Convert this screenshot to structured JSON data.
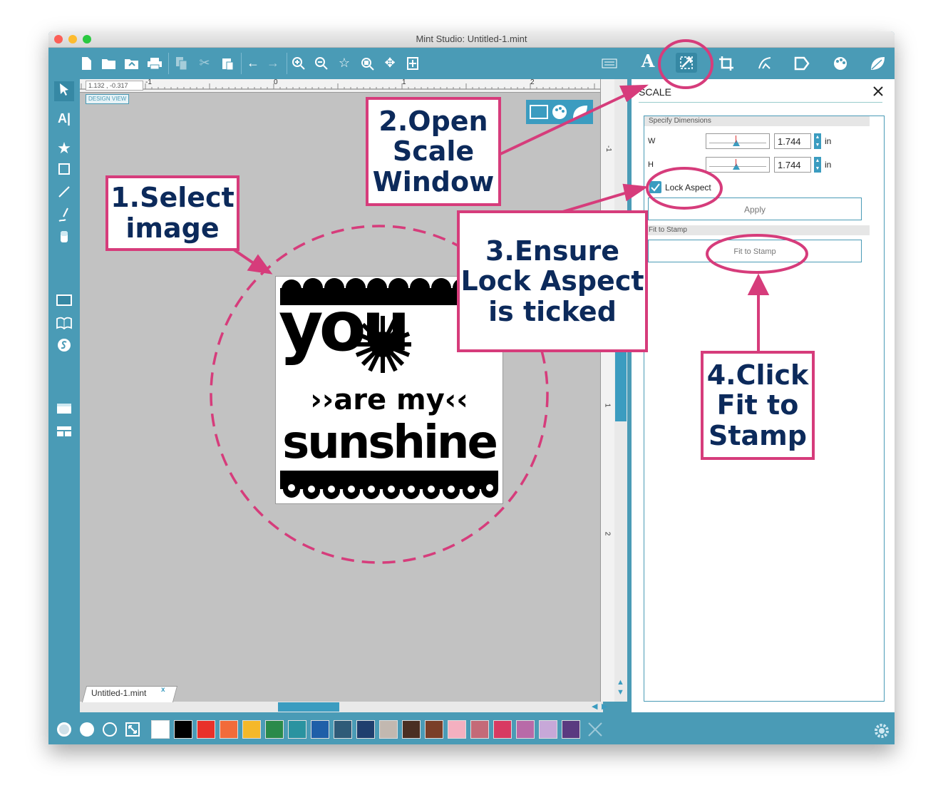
{
  "window": {
    "title": "Mint Studio: Untitled-1.mint"
  },
  "canvas": {
    "coords": "1.132 , -0.317",
    "view_label": "DESIGN VIEW",
    "doc_tab": "Untitled-1.mint",
    "doc_tab_close": "x",
    "ruler_top": [
      "-1",
      "0",
      "1",
      "2"
    ],
    "ruler_right": [
      "-1",
      "1",
      "2"
    ]
  },
  "artwork": {
    "line1": "you",
    "line2": "››are my‹‹",
    "line3": "sunshine"
  },
  "panel": {
    "title": "SCALE",
    "section1": "Specify Dimensions",
    "w_label": "W",
    "w_value": "1.744",
    "h_label": "H",
    "h_value": "1.744",
    "unit": "in",
    "lock_label": "Lock Aspect",
    "lock_checked": true,
    "apply_label": "Apply",
    "section2": "Fit to Stamp",
    "fit_label": "Fit to Stamp"
  },
  "callouts": {
    "c1": "1.Select image",
    "c2": "2.Open Scale Window",
    "c3": "3.Ensure Lock Aspect is ticked",
    "c4": "4.Click Fit to Stamp"
  },
  "colors": {
    "accent": "#4a9bb6",
    "annotation": "#d63c7b",
    "callout_text": "#0c2a5b",
    "swatches": [
      "#ffffff",
      "#000000",
      "#e8312a",
      "#f26b3a",
      "#f5b82a",
      "#2a8a4a",
      "#2a93a0",
      "#1f5fa8",
      "#2f5b78",
      "#1f3f6e",
      "#c2b8b0",
      "#4a2f22",
      "#7a3f28",
      "#f4b0c0",
      "#c46a78",
      "#d83a62",
      "#b86aa8",
      "#c7a8d8",
      "#5a3a80"
    ]
  },
  "icons": {
    "left_tools": [
      "pointer-icon",
      "text-tool-icon",
      "star-shape-icon",
      "rectangle-icon",
      "line-icon",
      "pen-icon",
      "eraser-icon",
      "design-view-icon",
      "library-icon",
      "store-icon",
      "layout-icon",
      "grid-icon"
    ],
    "right_tools": [
      "keyboard-icon",
      "text-style-icon",
      "scale-icon",
      "crop-icon",
      "trace-icon",
      "stamp-icon",
      "palette-icon",
      "leaf-icon"
    ]
  }
}
